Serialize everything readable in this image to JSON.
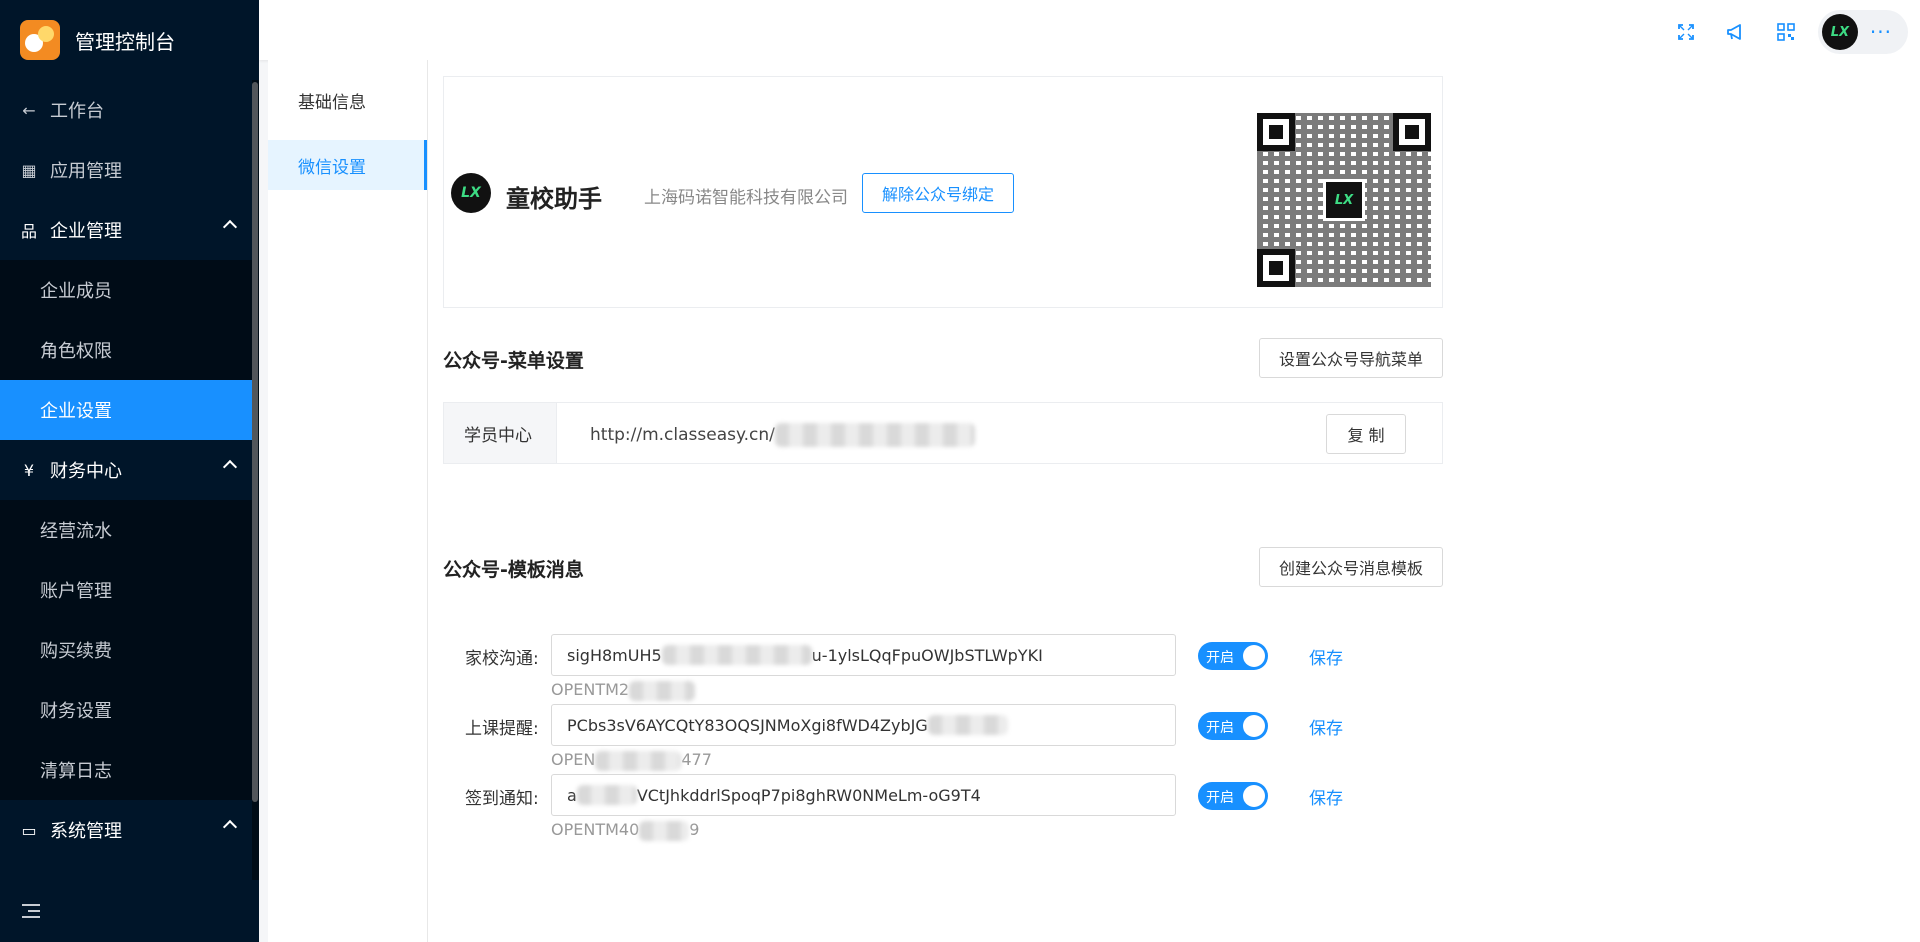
{
  "sidebar": {
    "brand": "管理控制台",
    "back_item": "工作台",
    "app_item": "应用管理",
    "enterprise_group": "企业管理",
    "enterprise_items": [
      "企业成员",
      "角色权限",
      "企业设置"
    ],
    "finance_group": "财务中心",
    "finance_items": [
      "经营流水",
      "账户管理",
      "购买续费",
      "财务设置",
      "清算日志"
    ],
    "system_group": "系统管理"
  },
  "header": {
    "avatar_text": "LX",
    "more": "···"
  },
  "tabs": [
    "基础信息",
    "微信设置"
  ],
  "card": {
    "app_logo_text": "LX",
    "app_name": "童校助手",
    "company": "上海码诺智能科技有限公司",
    "unbind_label": "解除公众号绑定",
    "qr_center_text": "LX"
  },
  "menu_section": {
    "title": "公众号-菜单设置",
    "button": "设置公众号导航菜单",
    "row_label": "学员中心",
    "url": "http://m.classeasy.cn/",
    "copy_label": "复 制"
  },
  "template_section": {
    "title": "公众号-模板消息",
    "button": "创建公众号消息模板",
    "rows": [
      {
        "label": "家校沟通:",
        "value_prefix": "sigH8mUH5",
        "value_suffix": "u-1ylsLQqFpuOWJbSTLWpYKI",
        "code_prefix": "OPENTM2",
        "code_suffix": "",
        "switch_text": "开启",
        "on": true,
        "save": "保存"
      },
      {
        "label": "上课提醒:",
        "value_prefix": "PCbs3sV6AYCQtY83OQSJNMoXgi8fWD4ZybJG",
        "value_suffix": "",
        "code_prefix": "OPEN",
        "code_suffix": "477",
        "switch_text": "开启",
        "on": true,
        "save": "保存"
      },
      {
        "label": "签到通知:",
        "value_prefix": "a",
        "value_suffix": "VCtJhkddrlSpoqP7pi8ghRW0NMeLm-oG9T4",
        "code_prefix": "OPENTM40",
        "code_suffix": "9",
        "switch_text": "开启",
        "on": true,
        "save": "保存"
      }
    ]
  },
  "colors": {
    "sidebar_bg": "#001529",
    "accent": "#1890ff"
  }
}
